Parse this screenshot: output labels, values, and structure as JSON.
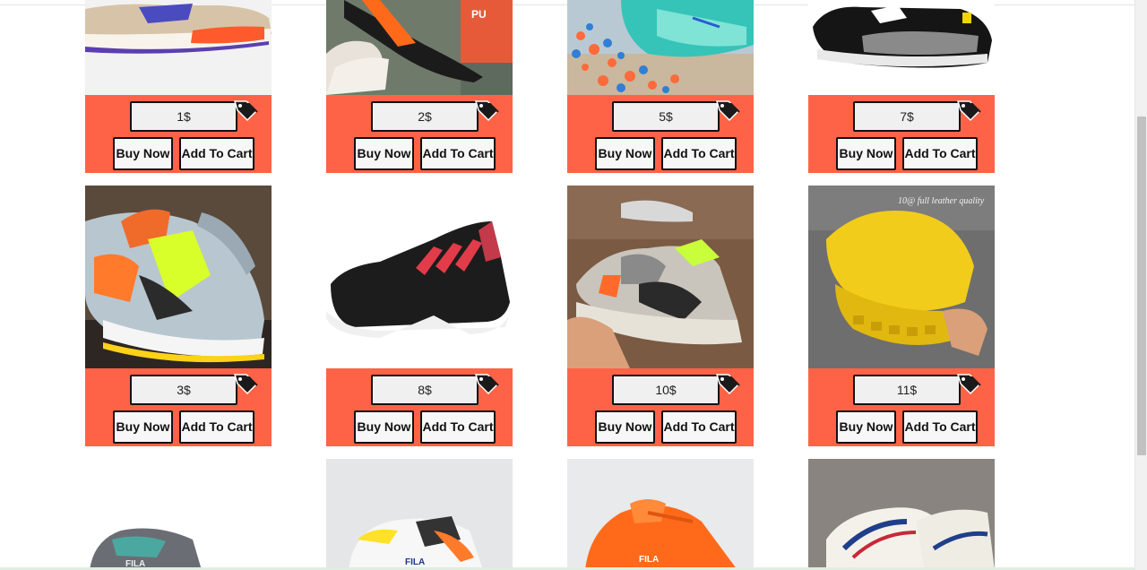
{
  "colors": {
    "panel": "#ff6347",
    "button_bg": "#f7f7f7",
    "border": "#111111"
  },
  "products": [
    {
      "price": "1$",
      "buy_label": "Buy Now",
      "cart_label": "Add To Cart",
      "image": "shoe-white-orange-purple-sole"
    },
    {
      "price": "2$",
      "buy_label": "Buy Now",
      "cart_label": "Add To Cart",
      "image": "shoe-black-orange-puma-in-hand"
    },
    {
      "price": "5$",
      "buy_label": "Buy Now",
      "cart_label": "Add To Cart",
      "image": "shoe-teal-on-colorful-beads"
    },
    {
      "price": "7$",
      "buy_label": "Buy Now",
      "cart_label": "Add To Cart",
      "image": "shoe-black-grey-puma-ferrari"
    },
    {
      "price": "3$",
      "buy_label": "Buy Now",
      "cart_label": "Add To Cart",
      "image": "shoe-grey-neon-yellow-orange"
    },
    {
      "price": "8$",
      "buy_label": "Buy Now",
      "cart_label": "Add To Cart",
      "image": "shoe-black-red-stripes-adidas"
    },
    {
      "price": "10$",
      "buy_label": "Buy Now",
      "cart_label": "Add To Cart",
      "image": "shoe-yeezy-in-hand"
    },
    {
      "price": "11$",
      "buy_label": "Buy Now",
      "cart_label": "Add To Cart",
      "image": "shoe-yellow-fila-in-hand"
    },
    {
      "image": "shoe-grey-fila-partial"
    },
    {
      "image": "shoe-white-multicolor-fila-partial"
    },
    {
      "image": "shoe-orange-fila-partial"
    },
    {
      "image": "shoe-white-blue-red-stripes-partial"
    }
  ]
}
